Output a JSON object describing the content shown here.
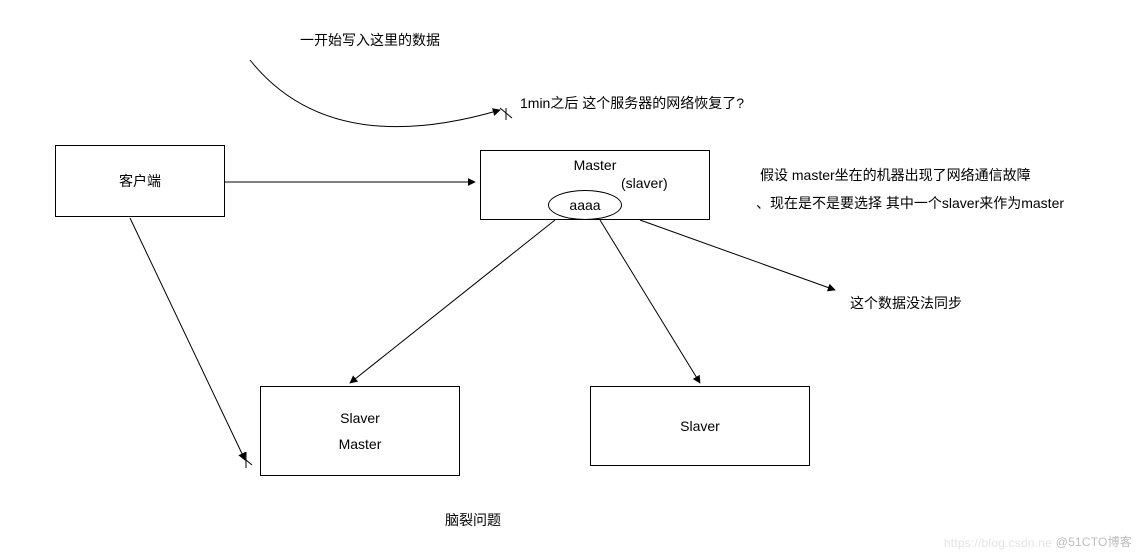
{
  "annotations": {
    "top_curve": "一开始写入这里的数据",
    "recover": "1min之后 这个服务器的网络恢复了?",
    "assume_line1": "假设 master坐在的机器出现了网络通信故障",
    "assume_line2": "、现在是不是要选择 其中一个slaver来作为master",
    "no_sync": "这个数据没法同步",
    "title": "脑裂问题"
  },
  "nodes": {
    "client": "客户端",
    "master_line1": "Master",
    "master_line2": "(slaver)",
    "master_data": "aaaa",
    "slaver_left_line1": "Slaver",
    "slaver_left_line2": "Master",
    "slaver_right": "Slaver"
  },
  "watermark": {
    "primary": "@51CTO博客",
    "secondary": "https://blog.csdn.ne"
  }
}
